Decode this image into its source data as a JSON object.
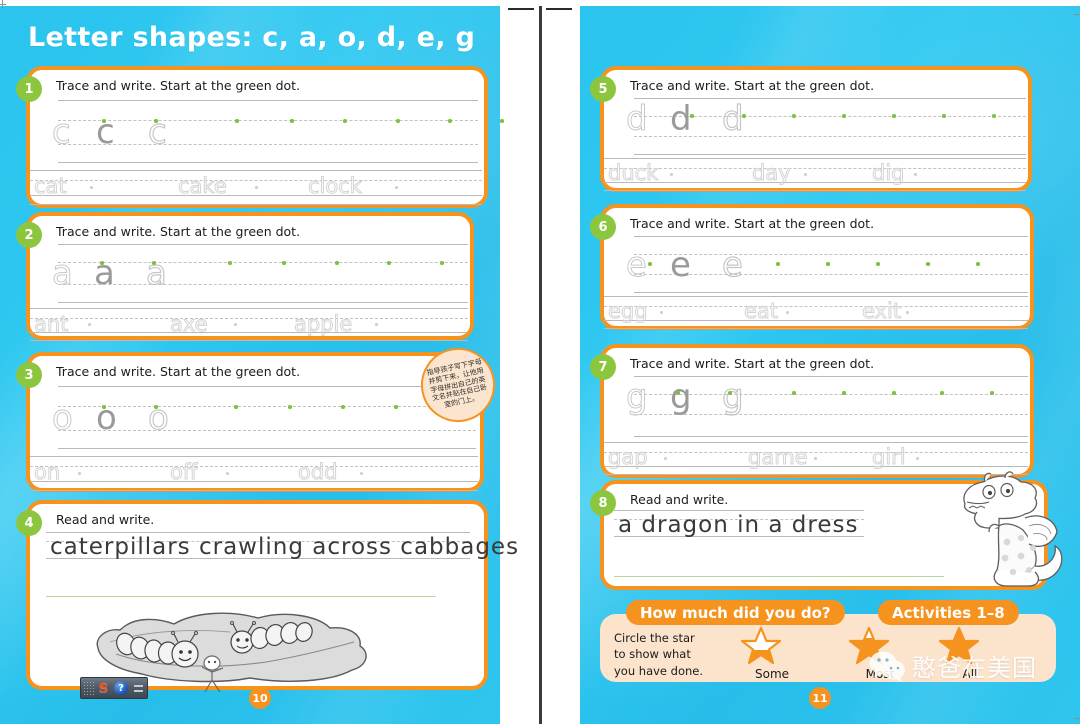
{
  "spread": {
    "title": "Letter shapes: c, a, o, d, e, g",
    "left_page_number": "10",
    "right_page_number": "11",
    "background_color": "#2BC4EE",
    "card_border_color": "#F6931E",
    "badge_color": "#8CC63F"
  },
  "activities": [
    {
      "number": "1",
      "instruction": "Trace and write. Start at the green dot.",
      "letter": "c",
      "words": [
        "cat",
        "cake",
        "clock"
      ]
    },
    {
      "number": "2",
      "instruction": "Trace and write. Start at the green dot.",
      "letter": "a",
      "words": [
        "ant",
        "axe",
        "apple"
      ]
    },
    {
      "number": "3",
      "instruction": "Trace and write. Start at the green dot.",
      "letter": "o",
      "words": [
        "on",
        "off",
        "odd"
      ]
    },
    {
      "number": "4",
      "instruction": "Read and write.",
      "phrase": "caterpillars crawling across cabbages",
      "illustration": "caterpillars-on-cabbage-leaf"
    },
    {
      "number": "5",
      "instruction": "Trace and write. Start at the green dot.",
      "letter": "d",
      "words": [
        "duck",
        "day",
        "dig"
      ]
    },
    {
      "number": "6",
      "instruction": "Trace and write. Start at the green dot.",
      "letter": "e",
      "words": [
        "egg",
        "eat",
        "exit"
      ]
    },
    {
      "number": "7",
      "instruction": "Trace and write. Start at the green dot.",
      "letter": "g",
      "words": [
        "gap",
        "game",
        "girl"
      ]
    },
    {
      "number": "8",
      "instruction": "Read and write.",
      "phrase": "a dragon in a dress",
      "illustration": "dragon-in-polka-dot-dress"
    }
  ],
  "tip_bubble": {
    "text": "指导孩子写下字母并剪下来，让他用字母拼出自己的英文名并贴在自己卧室的门上。"
  },
  "assessment": {
    "title": "How much did you do?",
    "activities_label": "Activities 1–8",
    "instruction": "Circle the star\nto show what\nyou have done.",
    "instruction_lines": [
      "Circle the star",
      "to show what",
      "you have done."
    ],
    "stars": [
      {
        "label": "Some",
        "fill": "partial-third"
      },
      {
        "label": "Most",
        "fill": "two-thirds"
      },
      {
        "label": "All",
        "fill": "full"
      }
    ],
    "star_color": "#F6931E",
    "panel_color": "#FBE3CC"
  },
  "ime_toolbar": {
    "logo": "sogou-s-logo",
    "help": "?",
    "keyboard": "keyboard-icon"
  },
  "watermark": {
    "icon": "wechat-icon",
    "text": "憨爸在美国"
  }
}
